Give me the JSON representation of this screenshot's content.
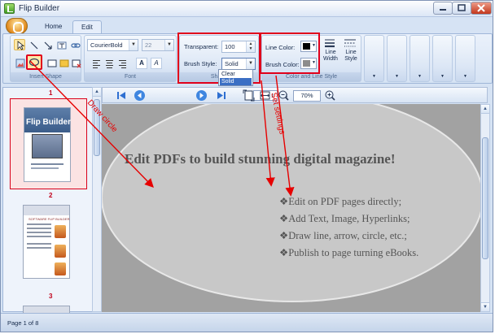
{
  "window": {
    "title": "Flip Builder"
  },
  "tabs": [
    {
      "label": "Home"
    },
    {
      "label": "Edit"
    }
  ],
  "ribbon": {
    "groups": {
      "insert_shape": "Insert Shape",
      "font": "Font",
      "shape": "Shape",
      "color_line": "Color and Line Style"
    },
    "font": {
      "family": "CourierBold",
      "size": "22",
      "format_buttons": [
        "A",
        "A"
      ]
    },
    "shape": {
      "transparent_label": "Transparent:",
      "transparent_value": "100",
      "brush_style_label": "Brush Style:",
      "brush_style_value": "Solid",
      "brush_style_options": [
        "Clear",
        "Solid"
      ]
    },
    "color_line": {
      "line_color_label": "Line Color:",
      "brush_color_label": "Brush Color:",
      "line_width_label": "Line Width",
      "line_style_label": "Line Style",
      "line_color": "#000000",
      "brush_color": "#8c8c8c"
    }
  },
  "thumbnails": [
    {
      "number": "1",
      "title": "Flip Builder"
    },
    {
      "number": "2",
      "title": "SOFTWARE FLIP BUILDER"
    },
    {
      "number": "3"
    }
  ],
  "navigation": {
    "current_page": "1",
    "total_pages": "/ 8",
    "zoom": "70%"
  },
  "page_content": {
    "headline": "Edit PDFs to build stunning digital magazine!",
    "bullets": [
      "Edit on PDF pages directly;",
      "Add Text, Image, Hyperlinks;",
      "Draw line, arrow, circle, etc.;",
      "Publish to page turning eBooks."
    ]
  },
  "annotations": {
    "draw_circle": "Draw circle",
    "set_settings": "Set settings",
    "color": "#e60000"
  },
  "status": {
    "text": "Page 1 of 8"
  },
  "colors": {
    "accent_red": "#e0001b",
    "ribbon_blue": "#d6e3f4",
    "ellipse_fill": "#c8c8c8"
  }
}
